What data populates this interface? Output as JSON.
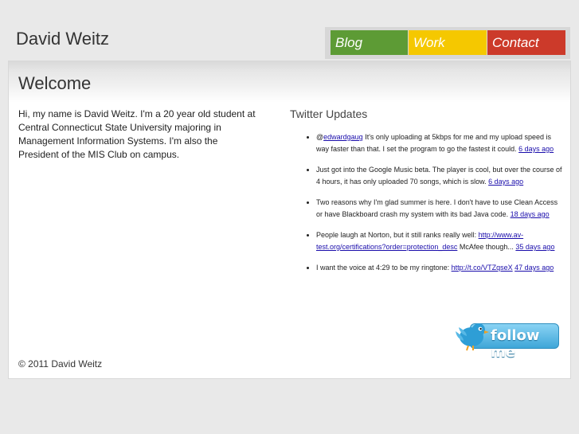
{
  "header": {
    "site_title": "David Weitz"
  },
  "nav": {
    "blog": "Blog",
    "work": "Work",
    "contact": "Contact"
  },
  "main": {
    "title": "Welcome",
    "intro": "Hi, my name is David Weitz. I'm a 20 year old student at Central Connecticut State University majoring in Management Information Systems. I'm also the President of the MIS Club on campus."
  },
  "twitter": {
    "title": "Twitter Updates",
    "tweets": [
      {
        "prefix": "@",
        "mention": "edwardgaug",
        "text": " It's only uploading at 5kbps for me and my upload speed is way faster than that. I set the program to go the fastest it could. ",
        "time": "6 days ago"
      },
      {
        "text": "Just got into the Google Music beta. The player is cool, but over the course of 4 hours, it has only uploaded 70 songs, which is slow. ",
        "time": "6 days ago"
      },
      {
        "text": "Two reasons why I'm glad summer is here. I don't have to use Clean Access or have Blackboard crash my system with its bad Java code. ",
        "time": "18 days ago"
      },
      {
        "text": "People laugh at Norton, but it still ranks really well: ",
        "link": "http://www.av-test.org/certifications?order=protection_desc",
        "text2": " McAfee though... ",
        "time": "35 days ago"
      },
      {
        "text": "I want the voice at 4:29 to be my ringtone: ",
        "link": "http://t.co/VTZqseX",
        "time": "47 days ago"
      }
    ],
    "follow_label": "follow me",
    "colors": {
      "bird": "#2e9ed6",
      "button": "#3ea6d8"
    }
  },
  "footer": {
    "copyright": "© 2011 David Weitz"
  }
}
